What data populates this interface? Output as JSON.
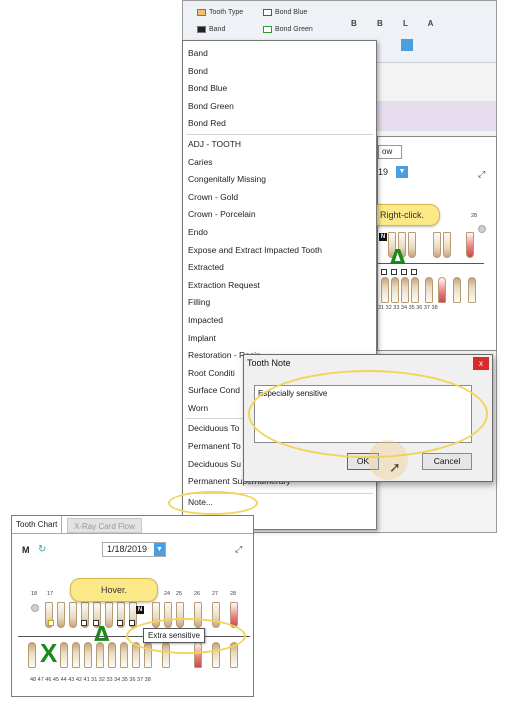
{
  "ribbon": {
    "tooth_type": "Tooth Type",
    "bond_blue": "Bond Blue",
    "band": "Band",
    "bond_green": "Bond Green",
    "letters": "B B L A"
  },
  "background_chart": {
    "tab": "ow",
    "date": "19",
    "upper_num": "28",
    "lower_nums": "31 32 33 34 35 36 37 38"
  },
  "bubbles": {
    "right_click": "Right-click.",
    "hover": "Hover."
  },
  "menu": {
    "group1": [
      "Band",
      "Bond",
      "Bond Blue",
      "Bond Green",
      "Bond Red"
    ],
    "group2": [
      "ADJ - TOOTH",
      "Caries",
      "Congenitally Missing",
      "Crown - Gold",
      "Crown - Porcelain",
      "Endo",
      "Expose and Extract Impacted Tooth",
      "Extracted",
      "Extraction Request",
      "Filling",
      "Impacted",
      "Implant",
      "Restoration - Resin",
      "Root Conditi",
      "Surface Cond",
      "Worn"
    ],
    "group3": [
      "Deciduous To",
      "Permanent To",
      "Deciduous Su",
      "Permanent Supernumerary"
    ],
    "note": "Note..."
  },
  "dialog": {
    "title": "Tooth Note",
    "close": "x",
    "text": "Especially sensitive",
    "ok": "OK",
    "cancel": "Cancel"
  },
  "fg_chart": {
    "tab1": "Tooth Chart",
    "tab2": "X-Ray Card Flow",
    "m_label": "M",
    "date": "1/18/2019",
    "dropdown_glyph": "▼",
    "expand_glyph": "⤢",
    "upper_nums": [
      "18",
      "17",
      "24",
      "25",
      "26",
      "27",
      "28"
    ],
    "lower_nums": "48  47  46  45  44  43  42  41  31  32  33  34  35  36  37  38",
    "n_badge": "N",
    "tooltip": "Extra sensitive"
  }
}
